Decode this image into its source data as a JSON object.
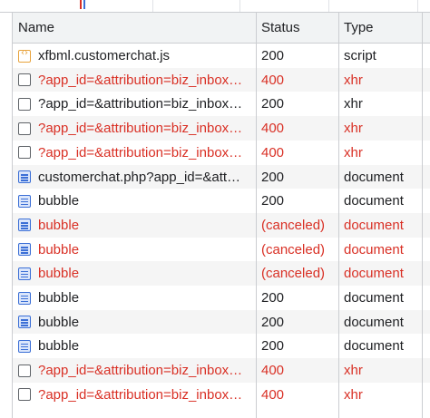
{
  "columns": {
    "name": "Name",
    "status": "Status",
    "type": "Type"
  },
  "colors": {
    "error": "#d93025",
    "script_icon": "#e8a33d",
    "document_icon": "#3b6fd6"
  },
  "rows": [
    {
      "name": "xfbml.customerchat.js",
      "status": "200",
      "type": "script",
      "icon": "script-icon",
      "error": false
    },
    {
      "name": "?app_id=&attribution=biz_inbox…",
      "status": "400",
      "type": "xhr",
      "icon": "xhr-icon",
      "error": true
    },
    {
      "name": "?app_id=&attribution=biz_inbox…",
      "status": "200",
      "type": "xhr",
      "icon": "xhr-icon",
      "error": false
    },
    {
      "name": "?app_id=&attribution=biz_inbox…",
      "status": "400",
      "type": "xhr",
      "icon": "xhr-icon",
      "error": true
    },
    {
      "name": "?app_id=&attribution=biz_inbox…",
      "status": "400",
      "type": "xhr",
      "icon": "xhr-icon",
      "error": true
    },
    {
      "name": "customerchat.php?app_id=&att…",
      "status": "200",
      "type": "document",
      "icon": "document-icon",
      "error": false
    },
    {
      "name": "bubble",
      "status": "200",
      "type": "document",
      "icon": "document-icon",
      "error": false
    },
    {
      "name": "bubble",
      "status": "(canceled)",
      "type": "document",
      "icon": "document-icon",
      "error": true
    },
    {
      "name": "bubble",
      "status": "(canceled)",
      "type": "document",
      "icon": "document-icon",
      "error": true
    },
    {
      "name": "bubble",
      "status": "(canceled)",
      "type": "document",
      "icon": "document-icon",
      "error": true
    },
    {
      "name": "bubble",
      "status": "200",
      "type": "document",
      "icon": "document-icon",
      "error": false
    },
    {
      "name": "bubble",
      "status": "200",
      "type": "document",
      "icon": "document-icon",
      "error": false
    },
    {
      "name": "bubble",
      "status": "200",
      "type": "document",
      "icon": "document-icon",
      "error": false
    },
    {
      "name": "?app_id=&attribution=biz_inbox…",
      "status": "400",
      "type": "xhr",
      "icon": "xhr-icon",
      "error": true
    },
    {
      "name": "?app_id=&attribution=biz_inbox…",
      "status": "400",
      "type": "xhr",
      "icon": "xhr-icon",
      "error": true
    }
  ]
}
